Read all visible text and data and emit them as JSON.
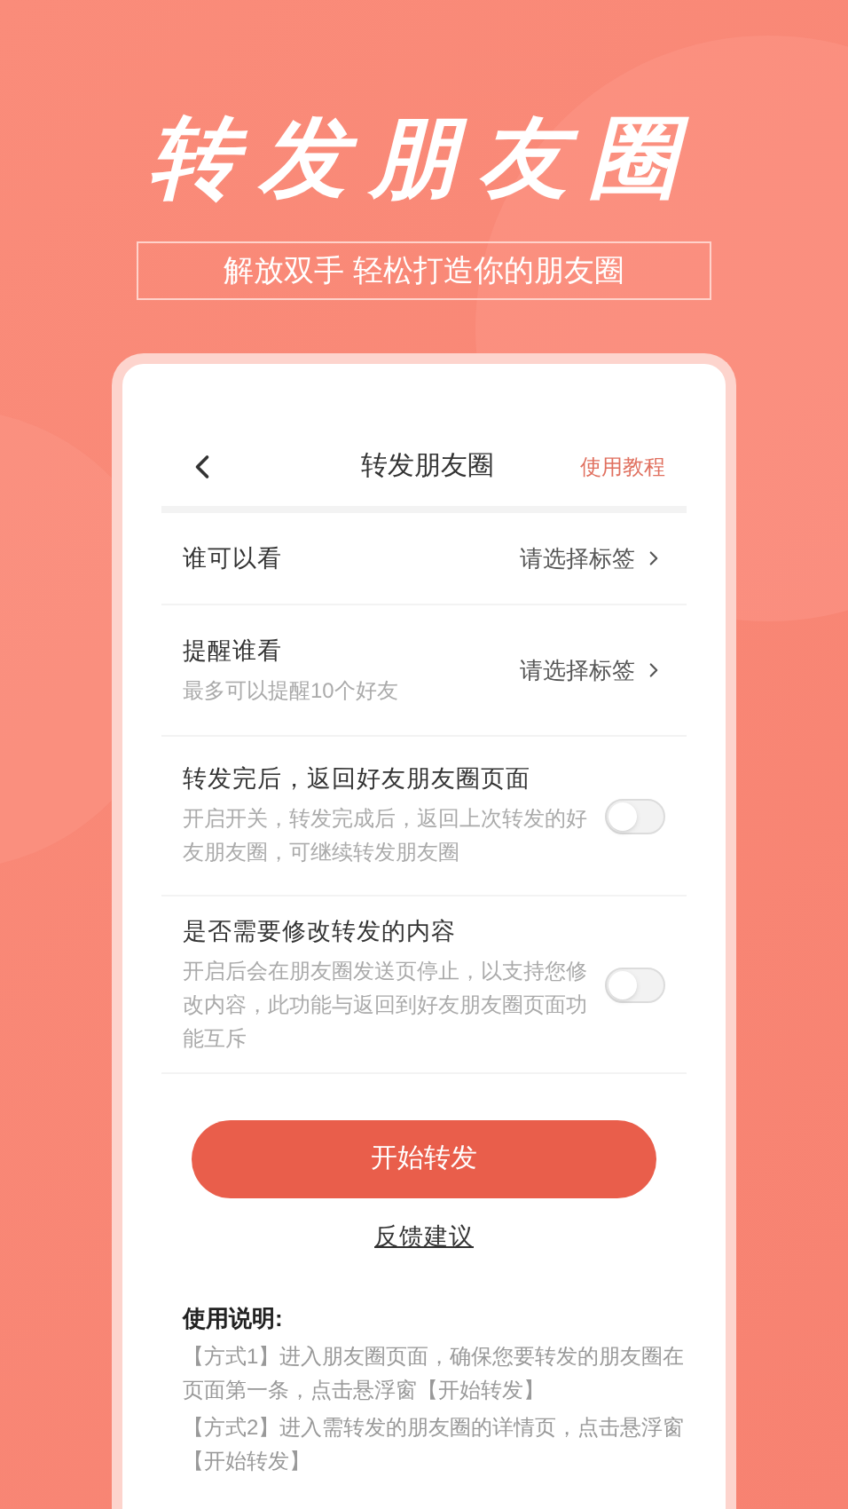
{
  "hero": {
    "title": "转发朋友圈",
    "subtitle": "解放双手 轻松打造你的朋友圈"
  },
  "header": {
    "title": "转发朋友圈",
    "link": "使用教程"
  },
  "settings": [
    {
      "kind": "select",
      "label": "谁可以看",
      "value": "请选择标签"
    },
    {
      "kind": "select",
      "label": "提醒谁看",
      "description": "最多可以提醒10个好友",
      "value": "请选择标签"
    },
    {
      "kind": "toggle",
      "label": "转发完后，返回好友朋友圈页面",
      "description": "开启开关，转发完成后，返回上次转发的好友朋友圈，可继续转发朋友圈",
      "on": false
    },
    {
      "kind": "toggle",
      "label": "是否需要修改转发的内容",
      "description": "开启后会在朋友圈发送页停止，以支持您修改内容，此功能与返回到好友朋友圈页面功能互斥",
      "on": false
    }
  ],
  "start_button": "开始转发",
  "feedback_link": "反馈建议",
  "instructions": {
    "title": "使用说明:",
    "lines": [
      "【方式1】进入朋友圈页面，确保您要转发的朋友圈在页面第一条，点击悬浮窗【开始转发】",
      "【方式2】进入需转发的朋友圈的详情页，点击悬浮窗【开始转发】"
    ]
  }
}
